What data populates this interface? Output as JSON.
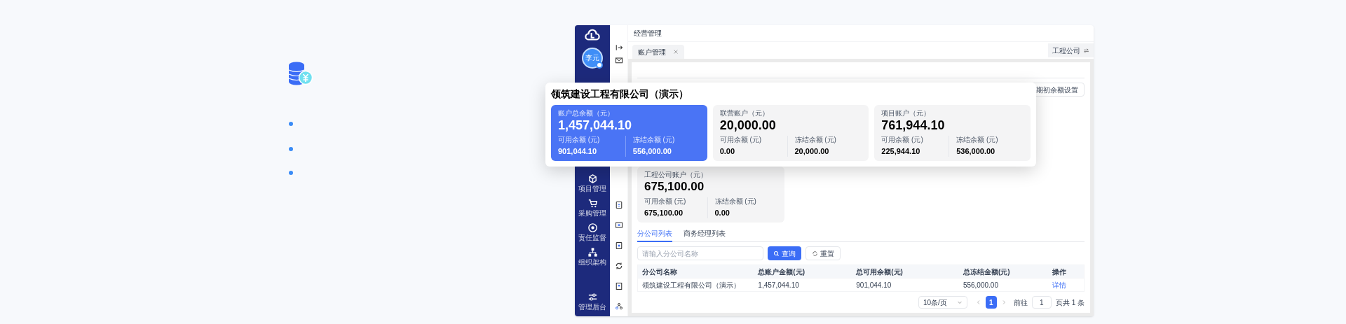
{
  "sidebar": {
    "avatar": "李元",
    "items": [
      {
        "label": "项目管理"
      },
      {
        "label": "采购管理"
      },
      {
        "label": "责任监督"
      },
      {
        "label": "组织架构"
      },
      {
        "label": "管理后台"
      }
    ]
  },
  "topbar": {
    "title": "经营管理"
  },
  "tabs": [
    {
      "label": "账户管理",
      "selected": true
    }
  ],
  "company_switch": "工程公司",
  "opening_balance_button": "期初余额设置",
  "overlay": {
    "title": "领筑建设工程有限公司（演示）",
    "cards": [
      {
        "selected": true,
        "label": "账户总余额（元）",
        "amount": "1,457,044.10",
        "available_label": "可用余额 (元)",
        "available": "901,044.10",
        "frozen_label": "冻结余额 (元)",
        "frozen": "556,000.00"
      },
      {
        "selected": false,
        "label": "联营账户（元）",
        "amount": "20,000.00",
        "available_label": "可用余额 (元)",
        "available": "0.00",
        "frozen_label": "冻结余额 (元)",
        "frozen": "20,000.00"
      },
      {
        "selected": false,
        "label": "项目账户（元）",
        "amount": "761,944.10",
        "available_label": "可用余额 (元)",
        "available": "225,944.10",
        "frozen_label": "冻结余额 (元)",
        "frozen": "536,000.00"
      }
    ]
  },
  "company_card": {
    "selected": false,
    "label": "工程公司账户（元）",
    "amount": "675,100.00",
    "available_label": "可用余额 (元)",
    "available": "675,100.00",
    "frozen_label": "冻结余额 (元)",
    "frozen": "0.00"
  },
  "list_tabs": [
    {
      "label": "分公司列表",
      "selected": true
    },
    {
      "label": "商务经理列表",
      "selected": false
    }
  ],
  "search": {
    "placeholder": "请输入分公司名称",
    "query_button": "查询",
    "reset_button": "重置"
  },
  "table": {
    "columns": [
      "分公司名称",
      "总账户金额(元)",
      "总可用余额(元)",
      "总冻结金额(元)",
      "操作"
    ],
    "rows": [
      {
        "cells": [
          "领筑建设工程有限公司（演示）",
          "1,457,044.10",
          "901,044.10",
          "556,000.00"
        ],
        "action": "详情"
      }
    ]
  },
  "pagination": {
    "page_size": "10条/页",
    "pages": [
      {
        "label": "1",
        "selected": true
      }
    ],
    "goto_label": "前往",
    "goto_value": "1",
    "total": "页共 1 条"
  }
}
